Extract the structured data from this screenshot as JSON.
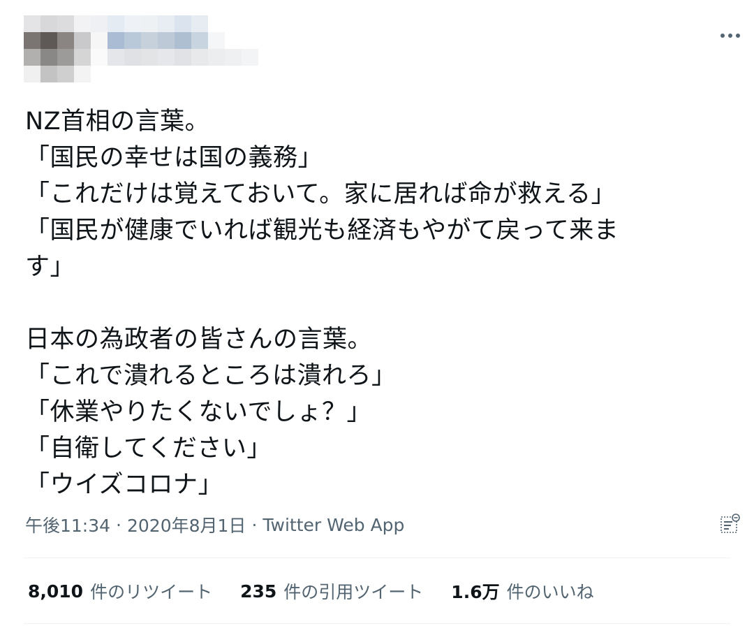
{
  "tweet": {
    "text_lines": [
      "NZ首相の言葉。",
      "「国民の幸せは国の義務」",
      "「これだけは覚えておいて。家に居れば命が救える」",
      "「国民が健康でいれば観光も経済もやがて戻って来ま",
      "す」",
      "",
      "日本の為政者の皆さんの言葉。",
      "「これで潰れるところは潰れろ」",
      "「休業やりたくないでしょ？」",
      "「自衛してください」",
      "「ウイズコロナ」"
    ],
    "time": "午後11:34",
    "separator": "·",
    "date": "2020年8月1日",
    "source": "Twitter Web App"
  },
  "stats": {
    "retweets": {
      "count": "8,010",
      "label": "件のリツイート"
    },
    "quotes": {
      "count": "235",
      "label": "件の引用ツイート"
    },
    "likes": {
      "count": "1.6万",
      "label": "件のいいね"
    }
  },
  "icons": {
    "more": "more-horizontal-icon",
    "analytics": "analytics-icon"
  },
  "colors": {
    "text": "#0f1419",
    "secondary": "#536471",
    "divider": "#eff3f4"
  }
}
